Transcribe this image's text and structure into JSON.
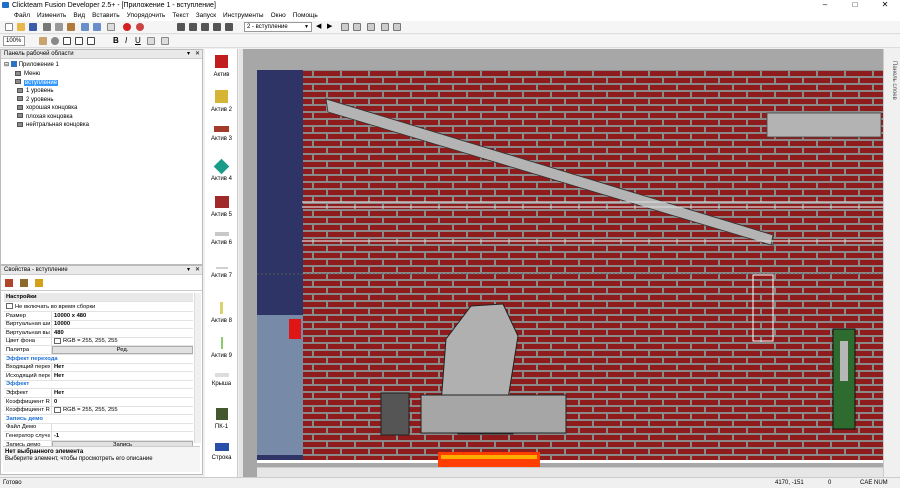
{
  "app": {
    "title": "Clickteam Fusion Developer 2.5+ - [Приложение 1 - вступление]",
    "window_controls": {
      "minimize": "–",
      "maximize": "□",
      "close": "✕"
    }
  },
  "menu": [
    "Файл",
    "Изменить",
    "Вид",
    "Вставить",
    "Упорядочить",
    "Текст",
    "Запуск",
    "Инструменты",
    "Окно",
    "Помощь"
  ],
  "toolbar": {
    "frame_select": "2 - вступление",
    "zoom": "100%"
  },
  "workspace": {
    "title": "Панель рабочей области",
    "root": "Приложение 1",
    "frames": [
      "Меню",
      "вступление",
      "1 уровень",
      "2 уровень",
      "хорошая концовка",
      "плохая концовка",
      "нейтральная концовка"
    ],
    "selected_index": 1
  },
  "properties": {
    "title": "Свойства - вступление",
    "header": "Настройки",
    "rows": [
      {
        "type": "check",
        "name": "Не включать во время сборки",
        "value": ""
      },
      {
        "type": "row",
        "name": "Размер",
        "value": "10000 x 480"
      },
      {
        "type": "row",
        "name": "Виртуальная шир",
        "value": "10000"
      },
      {
        "type": "row",
        "name": "Виртуальная выс",
        "value": "480"
      },
      {
        "type": "color",
        "name": "Цвет фона",
        "value": "RGB = 255, 255, 255"
      },
      {
        "type": "button",
        "name": "Палитра",
        "value": "Ред."
      },
      {
        "type": "cat",
        "name": "Эффект перехода",
        "value": ""
      },
      {
        "type": "row",
        "name": "Входящий перех",
        "value": "Нет"
      },
      {
        "type": "row",
        "name": "Исходящий пере",
        "value": "Нет"
      },
      {
        "type": "cat",
        "name": "Эффект",
        "value": ""
      },
      {
        "type": "row",
        "name": "Эффект",
        "value": "Нет"
      },
      {
        "type": "row",
        "name": "Коэффициент RG",
        "value": "0"
      },
      {
        "type": "color",
        "name": "Коэффициент RG",
        "value": "RGB = 255, 255, 255"
      },
      {
        "type": "cat",
        "name": "Запись демо",
        "value": ""
      },
      {
        "type": "row",
        "name": "Файл Демо",
        "value": ""
      },
      {
        "type": "row",
        "name": "Генератор случа",
        "value": "-1"
      },
      {
        "type": "button",
        "name": "Запись демо",
        "value": "Запись"
      }
    ],
    "footer_title": "Нет выбранного элемента",
    "footer_text": "Выберите элемент, чтобы просмотреть его описание"
  },
  "objects": [
    "Актив",
    "Актив 2",
    "Актив 3",
    "Актив 4",
    "Актив 5",
    "Актив 6",
    "Актив 7",
    "Актив 8",
    "Актив 9",
    "Крыша",
    "ПК-1",
    "Строка"
  ],
  "right_panel": "Панель слоев",
  "status": {
    "left": "Готово",
    "coords": "4170, -151",
    "zero": "0",
    "flags": "CAE NUM"
  },
  "colors": {
    "accent": "#3399ff",
    "brick": "#8e1c1c",
    "mortar": "#8a8a8a",
    "navy": "#2e3566"
  }
}
